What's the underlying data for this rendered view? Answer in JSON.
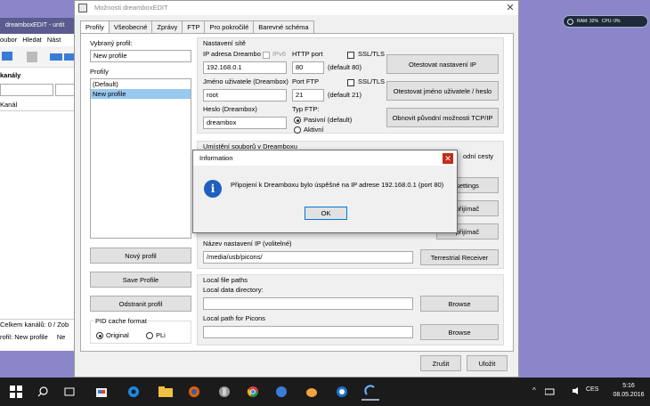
{
  "background_app": {
    "title": "dreamboxEDIT - untit",
    "menu": [
      "oubor",
      "Hledat",
      "Nást"
    ],
    "label_channels": "kanály",
    "column_channel": "Kanál",
    "status_channels": "Celkem kanálů: 0 / Zob",
    "status_profile": "rofil: New profile",
    "status_extra": "Ne"
  },
  "gadget": {
    "ram": "RAM: 32%",
    "cpu": "CPU: 0%"
  },
  "dialog": {
    "title": "Možnosti dreamboxEDIT",
    "close": "✕",
    "tabs": [
      "Profily",
      "Všeobecné",
      "Zprávy",
      "FTP",
      "Pro pokročilé",
      "Barevné schéma"
    ],
    "selected_profile_label": "Vybraný profil:",
    "selected_profile_value": "New profile",
    "profiles_label": "Profily",
    "profiles": [
      "(Default)",
      "New profile"
    ],
    "new_profile_btn": "Nový profil",
    "save_profile_btn": "Save Profile",
    "delete_profile_btn": "Odstranit profil",
    "pid_cache": {
      "label": "PID cache format",
      "original": "Original",
      "pli": "PLi"
    },
    "network": {
      "group_label": "Nastavení sítě",
      "ip_label": "IP adresa Dreambo",
      "ipv6_label": "IPv6",
      "ip_value": "192.168.0.1",
      "http_port_label": "HTTP port",
      "http_port_value": "80",
      "http_default": "(default 80)",
      "ssl_label": "SSL/TLS",
      "user_label": "Jméno uživatele (Dreambox)",
      "user_value": "root",
      "ftp_port_label": "Port FTP",
      "ftp_port_value": "21",
      "ftp_default": "(default 21)",
      "ssl2_label": "SSL/TLS",
      "pass_label": "Heslo (Dreambox)",
      "pass_value": "dreambox",
      "ftp_type_label": "Typ FTP:",
      "passive": "Pasivní (default)",
      "active": "Aktivní",
      "test_settings_btn": "Otestovat nastavení IP",
      "test_user_btn": "Otestovat jméno uživatele / heslo",
      "restore_btn": "Obnovit původní možnosti TCP/IP"
    },
    "storage": {
      "group_label": "Umístění souborů v Dreamboxu",
      "partial_right": "odní cesty",
      "settings_btn": "settings",
      "receiver_btn1": "přijímač",
      "receiver_btn2": "přijímač",
      "ip_name_label": "Název nastavení IP (volitelné)",
      "ip_name_value": "/media/usb/picons/",
      "terrestrial_btn": "Terrestrial Receiver"
    },
    "local": {
      "group_label": "Local file paths",
      "data_dir_label": "Local data directory:",
      "browse1": "Browse",
      "picons_label": "Local path for Picons",
      "browse2": "Browse"
    },
    "cancel_btn": "Zrušit",
    "save_btn": "Uložit"
  },
  "info": {
    "title": "Information",
    "icon": "i",
    "message": "Připojení k Dreamboxu bylo úspěšné na IP adrese 192.168.0.1 (port 80)",
    "ok": "OK"
  },
  "taskbar": {
    "time": "5:16",
    "date": "08.05.2016",
    "lang": "CES"
  }
}
